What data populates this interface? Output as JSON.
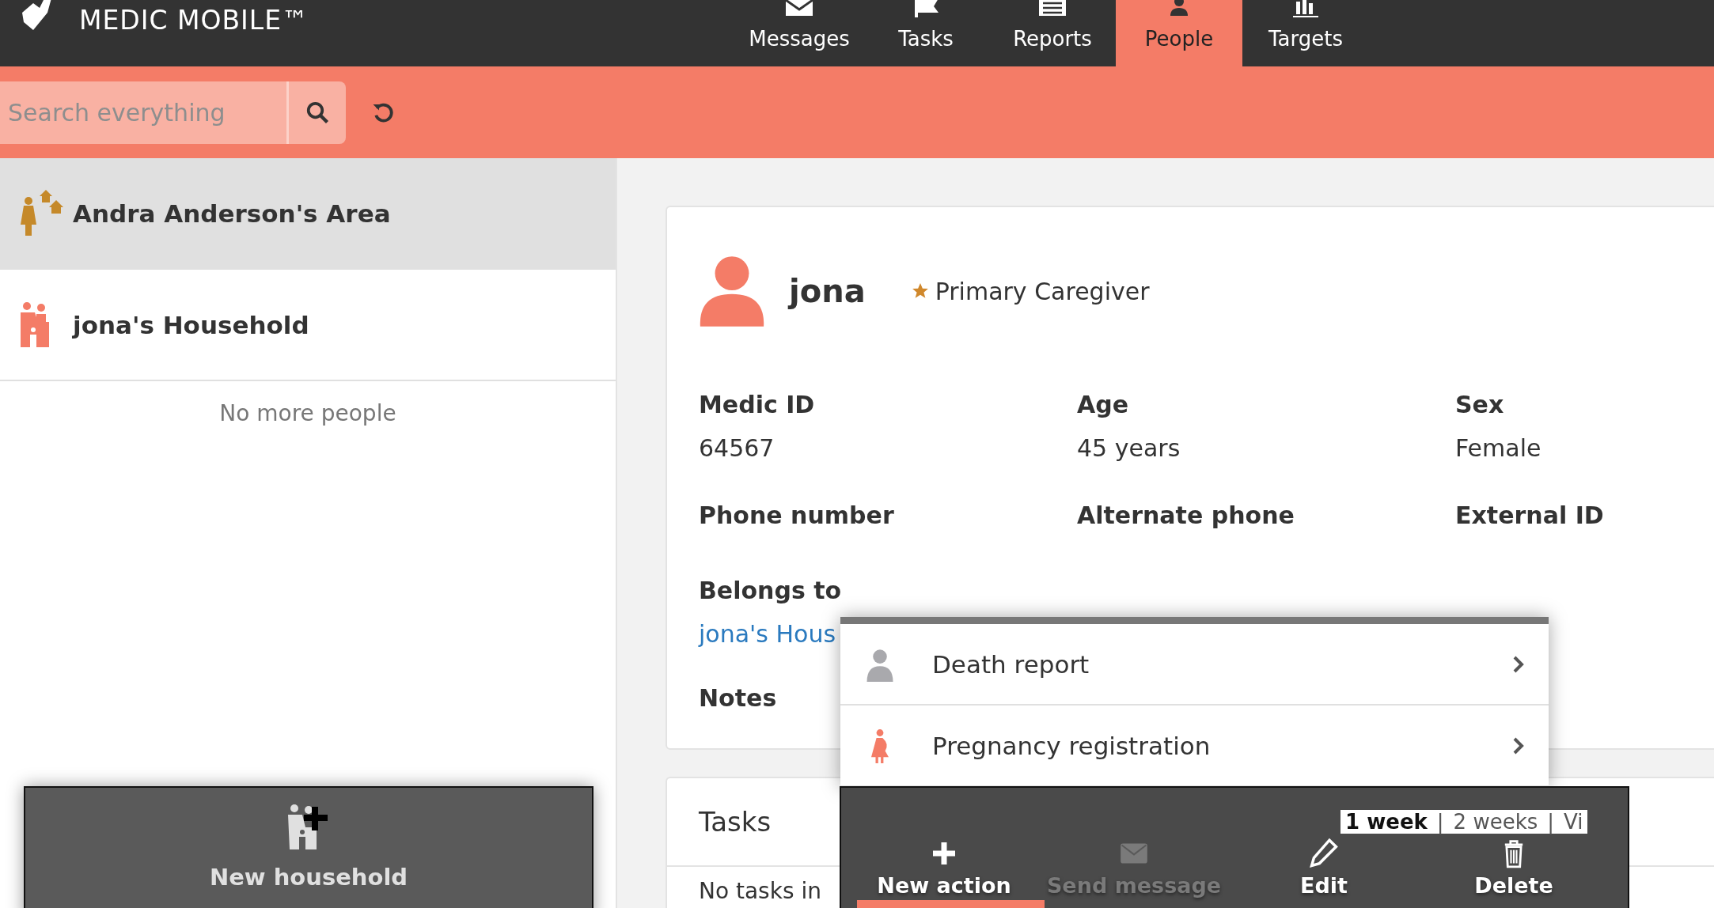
{
  "brand": {
    "name": "MEDIC MOBILE™"
  },
  "nav": [
    {
      "label": "Messages",
      "kind": "messages",
      "selected": false
    },
    {
      "label": "Tasks",
      "kind": "tasks",
      "selected": false
    },
    {
      "label": "Reports",
      "kind": "reports",
      "selected": false
    },
    {
      "label": "People",
      "kind": "people",
      "selected": true
    },
    {
      "label": "Targets",
      "kind": "targets",
      "selected": false
    }
  ],
  "search": {
    "placeholder": "Search everything"
  },
  "places": [
    {
      "name": "Andra Anderson's Area",
      "kind": "area",
      "selected": true
    },
    {
      "name": "jona's Household",
      "kind": "household",
      "selected": false
    }
  ],
  "list_footer": "No more people",
  "new_household": {
    "label": "New household"
  },
  "contact": {
    "name": "jona",
    "role": "Primary Caregiver",
    "fields": [
      {
        "label": "Medic ID",
        "value": "64567"
      },
      {
        "label": "Age",
        "value": "45 years"
      },
      {
        "label": "Sex",
        "value": "Female"
      },
      {
        "label": "Phone number"
      },
      {
        "label": "Alternate phone"
      },
      {
        "label": "External ID"
      }
    ],
    "belongs_to": {
      "label": "Belongs to",
      "link": "jona's Hous"
    },
    "notes": {
      "label": "Notes"
    }
  },
  "tasks": {
    "title": "Tasks",
    "separator": "|",
    "ranges": [
      {
        "label": "1 week",
        "selected": true
      },
      {
        "label": "2 weeks",
        "selected": false
      },
      {
        "label": "Vi",
        "selected": false
      }
    ],
    "empty": "No tasks in"
  },
  "action_menu": [
    {
      "label": "Death report",
      "kind": "death"
    },
    {
      "label": "Pregnancy registration",
      "kind": "pregnancy"
    }
  ],
  "actions": [
    {
      "label": "New action",
      "kind": "add",
      "disabled": false
    },
    {
      "label": "Send message",
      "kind": "message",
      "disabled": true
    },
    {
      "label": "Edit",
      "kind": "edit",
      "disabled": false
    },
    {
      "label": "Delete",
      "kind": "delete",
      "disabled": false
    }
  ]
}
